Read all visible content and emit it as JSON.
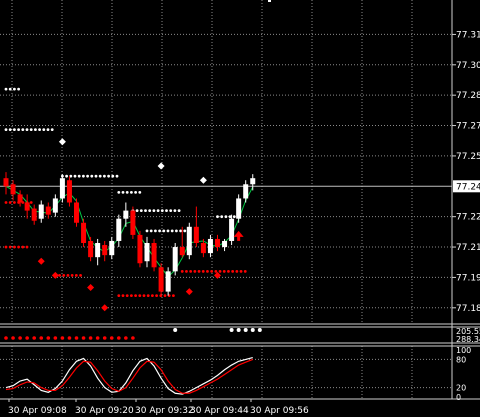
{
  "chart_data": [
    {
      "type": "candlestick",
      "x_ticks": [
        "30 Apr 09:08",
        "30 Apr 09:20",
        "30 Apr 09:32",
        "30 Apr 09:44",
        "30 Apr 09:56"
      ],
      "y_ticks": [
        "77.315",
        "77.300",
        "77.285",
        "77.270",
        "77.255",
        "77.225",
        "77.210",
        "77.195",
        "77.180"
      ],
      "current_price": "77.240",
      "ylim": [
        77.172,
        77.332
      ],
      "grid": true,
      "colors": {
        "up": "#ffffff",
        "down": "#ff0000",
        "line": "#00cc44",
        "dots_up": "#ffffff",
        "dots_down": "#ff0000"
      },
      "candles": [
        {
          "o": 77.244,
          "h": 77.247,
          "l": 77.236,
          "c": 77.24
        },
        {
          "o": 77.241,
          "h": 77.243,
          "l": 77.233,
          "c": 77.236
        },
        {
          "o": 77.236,
          "h": 77.238,
          "l": 77.23,
          "c": 77.232
        },
        {
          "o": 77.232,
          "h": 77.236,
          "l": 77.224,
          "c": 77.228
        },
        {
          "o": 77.229,
          "h": 77.231,
          "l": 77.221,
          "c": 77.223
        },
        {
          "o": 77.224,
          "h": 77.233,
          "l": 77.222,
          "c": 77.231
        },
        {
          "o": 77.23,
          "h": 77.232,
          "l": 77.224,
          "c": 77.226
        },
        {
          "o": 77.227,
          "h": 77.236,
          "l": 77.225,
          "c": 77.234
        },
        {
          "o": 77.234,
          "h": 77.246,
          "l": 77.232,
          "c": 77.244
        },
        {
          "o": 77.243,
          "h": 77.245,
          "l": 77.23,
          "c": 77.232
        },
        {
          "o": 77.232,
          "h": 77.234,
          "l": 77.22,
          "c": 77.222
        },
        {
          "o": 77.222,
          "h": 77.224,
          "l": 77.21,
          "c": 77.212
        },
        {
          "o": 77.213,
          "h": 77.215,
          "l": 77.203,
          "c": 77.205
        },
        {
          "o": 77.205,
          "h": 77.214,
          "l": 77.201,
          "c": 77.212
        },
        {
          "o": 77.211,
          "h": 77.213,
          "l": 77.203,
          "c": 77.206
        },
        {
          "o": 77.206,
          "h": 77.215,
          "l": 77.204,
          "c": 77.213
        },
        {
          "o": 77.213,
          "h": 77.226,
          "l": 77.21,
          "c": 77.224
        },
        {
          "o": 77.224,
          "h": 77.232,
          "l": 77.22,
          "c": 77.228
        },
        {
          "o": 77.228,
          "h": 77.23,
          "l": 77.214,
          "c": 77.216
        },
        {
          "o": 77.216,
          "h": 77.218,
          "l": 77.2,
          "c": 77.202
        },
        {
          "o": 77.203,
          "h": 77.215,
          "l": 77.2,
          "c": 77.212
        },
        {
          "o": 77.212,
          "h": 77.214,
          "l": 77.198,
          "c": 77.2
        },
        {
          "o": 77.2,
          "h": 77.202,
          "l": 77.186,
          "c": 77.188
        },
        {
          "o": 77.188,
          "h": 77.2,
          "l": 77.186,
          "c": 77.198
        },
        {
          "o": 77.198,
          "h": 77.212,
          "l": 77.196,
          "c": 77.21
        },
        {
          "o": 77.21,
          "h": 77.22,
          "l": 77.205,
          "c": 77.206
        },
        {
          "o": 77.206,
          "h": 77.222,
          "l": 77.204,
          "c": 77.22
        },
        {
          "o": 77.22,
          "h": 77.23,
          "l": 77.21,
          "c": 77.212
        },
        {
          "o": 77.212,
          "h": 77.214,
          "l": 77.205,
          "c": 77.207
        },
        {
          "o": 77.207,
          "h": 77.216,
          "l": 77.205,
          "c": 77.214
        },
        {
          "o": 77.214,
          "h": 77.216,
          "l": 77.208,
          "c": 77.21
        },
        {
          "o": 77.21,
          "h": 77.214,
          "l": 77.208,
          "c": 77.213
        },
        {
          "o": 77.213,
          "h": 77.226,
          "l": 77.211,
          "c": 77.224
        },
        {
          "o": 77.224,
          "h": 77.236,
          "l": 77.222,
          "c": 77.234
        },
        {
          "o": 77.234,
          "h": 77.243,
          "l": 77.232,
          "c": 77.241
        },
        {
          "o": 77.241,
          "h": 77.246,
          "l": 77.238,
          "c": 77.244
        }
      ],
      "resistance_dots": [
        {
          "x0": 0,
          "x1": 2,
          "y": 77.288
        },
        {
          "x0": 0,
          "x1": 7,
          "y": 77.268
        },
        {
          "x0": 8,
          "x1": 16,
          "y": 77.245
        },
        {
          "x0": 16,
          "x1": 19,
          "y": 77.237
        },
        {
          "x0": 18,
          "x1": 25,
          "y": 77.228
        },
        {
          "x0": 20,
          "x1": 26,
          "y": 77.218
        },
        {
          "x0": 30,
          "x1": 33,
          "y": 77.225
        }
      ],
      "support_dots": [
        {
          "x0": 0,
          "x1": 4,
          "y": 77.232
        },
        {
          "x0": 0,
          "x1": 3,
          "y": 77.21
        },
        {
          "x0": 7,
          "x1": 11,
          "y": 77.196
        },
        {
          "x0": 16,
          "x1": 24,
          "y": 77.186
        },
        {
          "x0": 25,
          "x1": 34,
          "y": 77.198
        }
      ],
      "diamonds_up": [
        {
          "i": 8,
          "y": 77.262
        },
        {
          "i": 22,
          "y": 77.25
        },
        {
          "i": 28,
          "y": 77.243
        }
      ],
      "diamonds_down": [
        {
          "i": 5,
          "y": 77.203
        },
        {
          "i": 7,
          "y": 77.196
        },
        {
          "i": 12,
          "y": 77.19
        },
        {
          "i": 14,
          "y": 77.18
        },
        {
          "i": 26,
          "y": 77.188
        },
        {
          "i": 30,
          "y": 77.196
        }
      ],
      "arrow_up": {
        "i": 33,
        "y": 77.215
      }
    },
    {
      "type": "indicator-dots",
      "labels": [
        "205.55",
        "288.34"
      ],
      "red_dots_range": [
        0,
        18
      ],
      "white_dots_range": [
        32,
        36
      ],
      "white_dot_single": 24
    },
    {
      "type": "line",
      "y_ticks": [
        "100",
        "80",
        "20",
        "0"
      ],
      "ylim": [
        0,
        100
      ],
      "series": [
        {
          "color": "#ffffff",
          "values": [
            20,
            24,
            34,
            38,
            26,
            14,
            10,
            18,
            34,
            58,
            76,
            82,
            66,
            40,
            20,
            10,
            12,
            30,
            56,
            76,
            82,
            66,
            40,
            18,
            8,
            6,
            12,
            20,
            28,
            36,
            46,
            58,
            68,
            76,
            80,
            84
          ]
        },
        {
          "color": "#ff0000",
          "values": [
            16,
            18,
            26,
            32,
            30,
            20,
            14,
            14,
            24,
            42,
            62,
            76,
            74,
            56,
            34,
            18,
            12,
            20,
            40,
            62,
            76,
            74,
            58,
            34,
            16,
            8,
            8,
            14,
            22,
            30,
            38,
            48,
            58,
            68,
            74,
            80
          ]
        }
      ]
    }
  ]
}
